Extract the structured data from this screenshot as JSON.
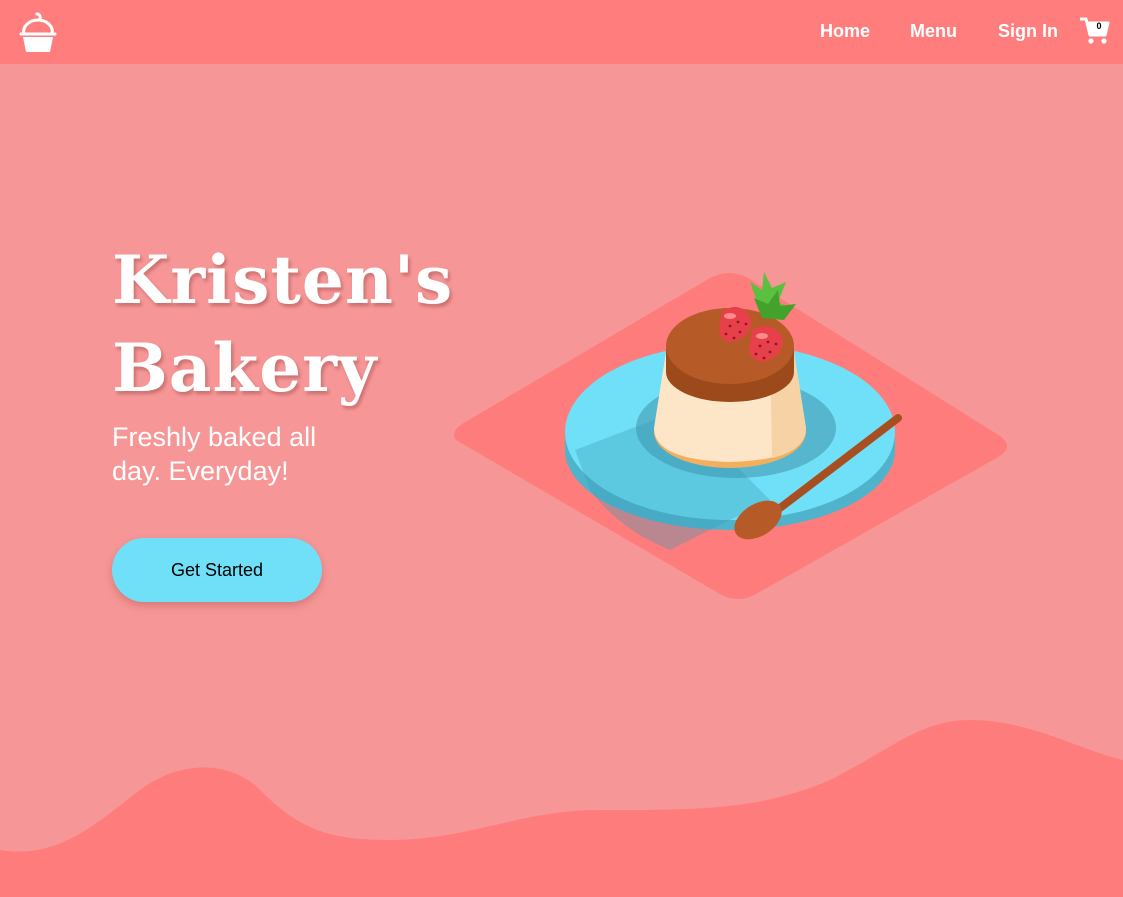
{
  "nav": {
    "logo_icon": "cupcake-icon",
    "links": [
      {
        "label": "Home"
      },
      {
        "label": "Menu"
      },
      {
        "label": "Sign In"
      }
    ],
    "cart": {
      "icon": "shopping-cart-icon",
      "count": "0"
    }
  },
  "hero": {
    "title_line1": "Kristen's",
    "title_line2": "Bakery",
    "subtitle": "Freshly baked all day. Everyday!",
    "cta_label": "Get Started",
    "illustration": "pudding-dessert-illustration"
  },
  "colors": {
    "navbar": "#ff7d7d",
    "background": "#f69696",
    "wave": "#ff7c7c",
    "button": "#6fe0f7",
    "text_light": "#ffffff"
  }
}
